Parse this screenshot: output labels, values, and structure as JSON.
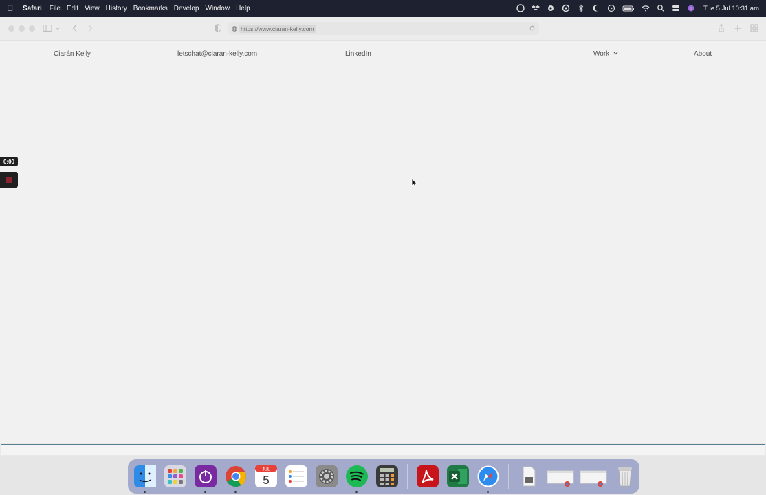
{
  "menubar": {
    "app_name": "Safari",
    "items": [
      "File",
      "Edit",
      "View",
      "History",
      "Bookmarks",
      "Develop",
      "Window",
      "Help"
    ],
    "clock": "Tue 5 Jul  10:31 am"
  },
  "browser": {
    "url": "https://www.ciaran-kelly.com"
  },
  "nav": {
    "name": "Ciarán Kelly",
    "email": "letschat@ciaran-kelly.com",
    "linkedin": "LinkedIn",
    "work": "Work",
    "about": "About"
  },
  "recorder": {
    "time": "0:00"
  },
  "dock": {
    "calendar_month": "JUL",
    "calendar_day": "5"
  },
  "colors": {
    "menubar_bg": "#1e2130",
    "page_bg": "#f1f1f1",
    "stop_red": "#8b2230"
  }
}
